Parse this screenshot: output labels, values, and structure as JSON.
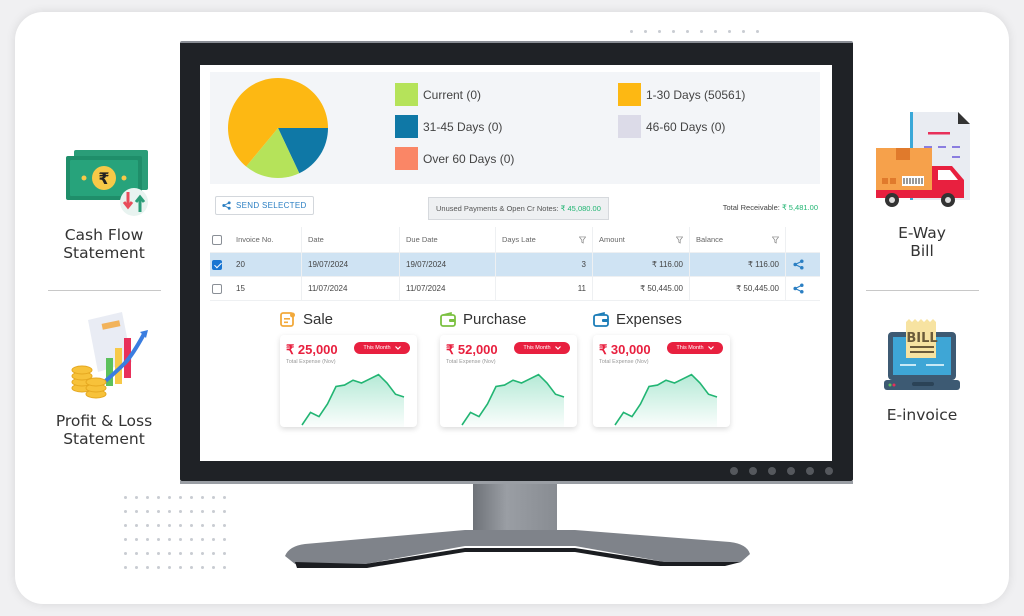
{
  "features_left": [
    {
      "label_line1": "Cash Flow",
      "label_line2": "Statement",
      "icon": "cash-flow-icon"
    },
    {
      "label_line1": "Profit & Loss",
      "label_line2": "Statement",
      "icon": "profit-loss-chart-icon"
    }
  ],
  "features_right": [
    {
      "label_line1": "E-Way",
      "label_line2": "Bill",
      "icon": "delivery-truck-icon"
    },
    {
      "label_line1": "E-invoice",
      "label_line2": "",
      "icon": "bill-laptop-icon"
    }
  ],
  "aging": {
    "legend": [
      {
        "label": "Current (0)",
        "color": "#b5e35a"
      },
      {
        "label": "1-30 Days (50561)",
        "color": "#fdb813"
      },
      {
        "label": "31-45 Days (0)",
        "color": "#0f78a6"
      },
      {
        "label": "46-60 Days (0)",
        "color": "#dcdbe8"
      },
      {
        "label": "Over 60 Days (0)",
        "color": "#fa8666"
      }
    ]
  },
  "chart_data": {
    "type": "pie",
    "title": "",
    "slices": [
      {
        "label": "1-30 Days",
        "value": 64,
        "color": "#fdb813"
      },
      {
        "label": "31-45 Days",
        "value": 18,
        "color": "#0f78a6"
      },
      {
        "label": "Current",
        "value": 18,
        "color": "#b5e35a"
      }
    ],
    "legend_placement": "right"
  },
  "toolbar": {
    "send_selected": "SEND SELECTED",
    "unused_label": "Unused Payments & Open Cr Notes:",
    "unused_value": "₹ 45,080.00",
    "total_label": "Total Receivable:",
    "total_value": "₹ 5,481.00"
  },
  "table": {
    "columns": [
      "Invoice No.",
      "Date",
      "Due Date",
      "Days Late",
      "Amount",
      "Balance"
    ],
    "rows": [
      {
        "selected": true,
        "invoice": "20",
        "date": "19/07/2024",
        "due": "19/07/2024",
        "days_late": "3",
        "amount": "₹ 116.00",
        "balance": "₹ 116.00"
      },
      {
        "selected": false,
        "invoice": "15",
        "date": "11/07/2024",
        "due": "11/07/2024",
        "days_late": "11",
        "amount": "₹ 50,445.00",
        "balance": "₹ 50,445.00"
      }
    ]
  },
  "metrics": [
    {
      "title": "Sale",
      "amount": "₹ 25,000",
      "subtitle": "Total Expense (Nov)",
      "period": "This Month",
      "icon": "invoice-icon",
      "icon_color": "#f2a93b",
      "trend": [
        0,
        18,
        12,
        30,
        55,
        57,
        64,
        60,
        66,
        72,
        60,
        44,
        40
      ]
    },
    {
      "title": "Purchase",
      "amount": "₹ 52,000",
      "subtitle": "Total Expense (Nov)",
      "period": "This Month",
      "icon": "wallet-icon",
      "icon_color": "#7cc142",
      "trend": [
        0,
        18,
        12,
        30,
        55,
        57,
        64,
        60,
        66,
        72,
        60,
        44,
        40
      ]
    },
    {
      "title": "Expenses",
      "amount": "₹ 30,000",
      "subtitle": "Total Expense (Nov)",
      "period": "This Month",
      "icon": "wallet-icon",
      "icon_color": "#1c7db8",
      "trend": [
        0,
        18,
        12,
        30,
        55,
        57,
        64,
        60,
        66,
        72,
        60,
        44,
        40
      ]
    }
  ]
}
